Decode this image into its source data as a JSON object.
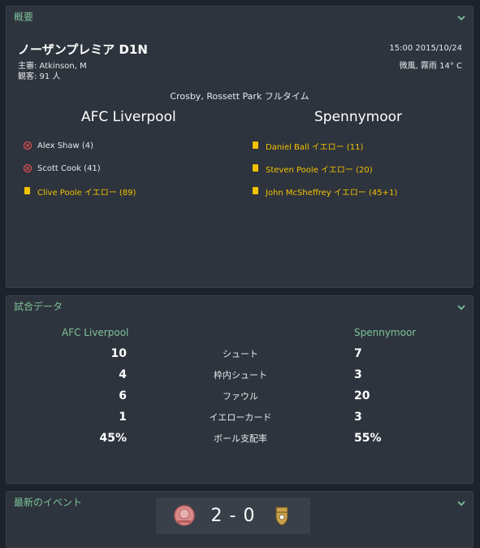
{
  "overview": {
    "title": "概要",
    "competition": "ノーザンプレミア D1N",
    "referee": "主審: Atkinson, M",
    "attendance": "観客: 91 人",
    "datetime": "15:00 2015/10/24",
    "weather": "微風, 霧雨 14° C",
    "venue": "Crosby, Rossett Park フルタイム",
    "home_team": "AFC Liverpool",
    "away_team": "Spennymoor",
    "home_events": [
      {
        "text": "Alex Shaw (4)",
        "type": "goal"
      },
      {
        "text": "Scott Cook (41)",
        "type": "goal"
      },
      {
        "text": "Clive Poole イエロー (89)",
        "type": "yellow"
      }
    ],
    "away_events": [
      {
        "text": "Daniel Ball イエロー (11)",
        "type": "yellow"
      },
      {
        "text": "Steven Poole イエロー (20)",
        "type": "yellow"
      },
      {
        "text": "John McSheffrey イエロー (45+1)",
        "type": "yellow"
      }
    ]
  },
  "stats": {
    "title": "試合データ",
    "home_team": "AFC Liverpool",
    "away_team": "Spennymoor",
    "rows": [
      {
        "label": "シュート",
        "home": "10",
        "away": "7"
      },
      {
        "label": "枠内シュート",
        "home": "4",
        "away": "3"
      },
      {
        "label": "ファウル",
        "home": "6",
        "away": "20"
      },
      {
        "label": "イエローカード",
        "home": "1",
        "away": "3"
      },
      {
        "label": "ボール支配率",
        "home": "45%",
        "away": "55%"
      }
    ]
  },
  "latest": {
    "title": "最新のイベント",
    "score": "2 - 0"
  },
  "colors": {
    "accent": "#7ec39a",
    "yellow_card": "#f2c200",
    "panel": "#2e343d",
    "background": "#1e232b"
  },
  "icons": {
    "collapse": "chevron-down-icon",
    "goal": "ball-icon",
    "yellow": "yellow-card-icon"
  }
}
